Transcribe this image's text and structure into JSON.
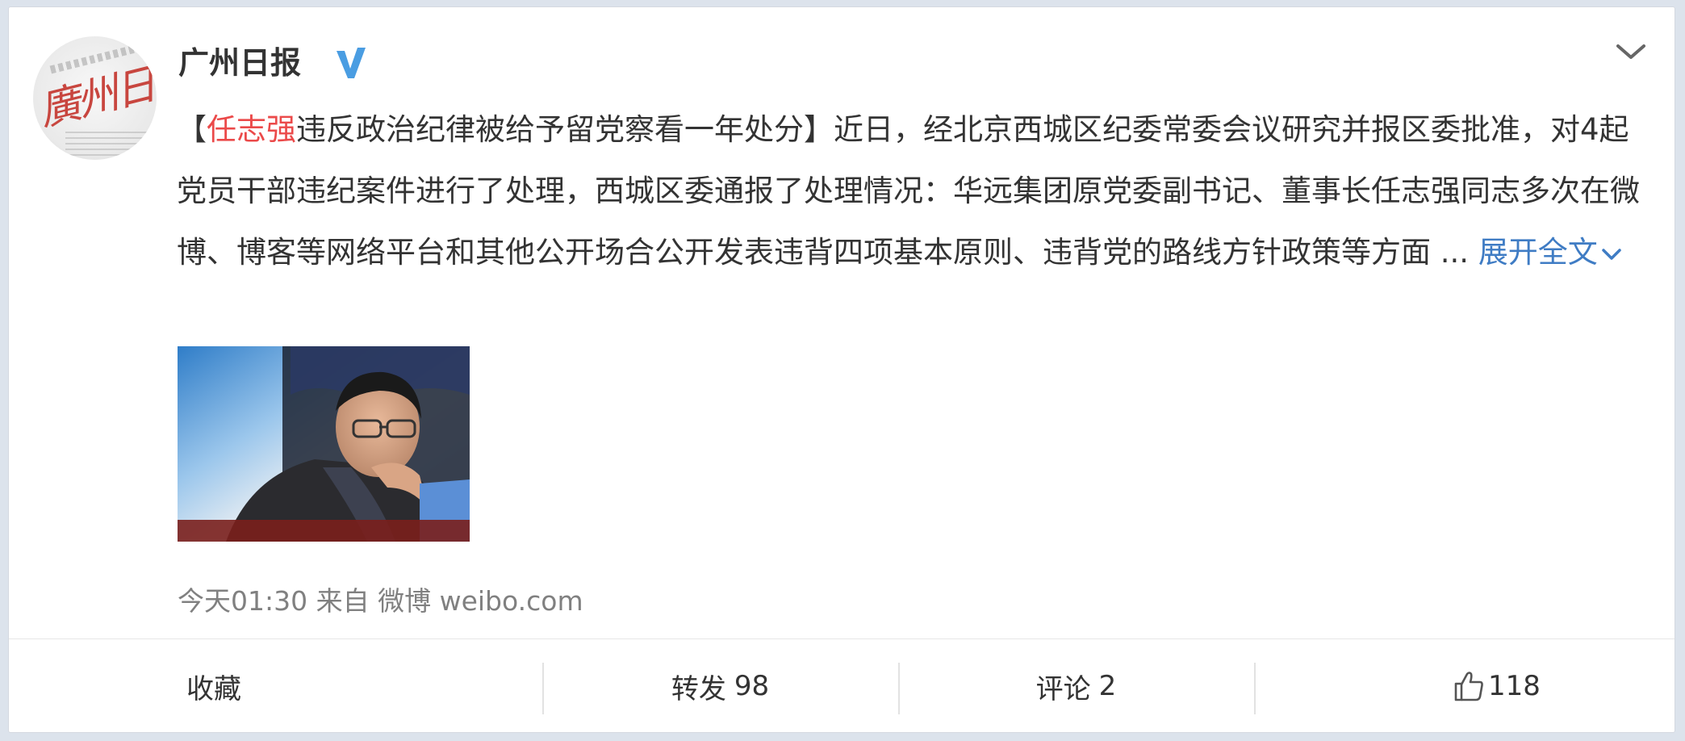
{
  "post": {
    "author": "广州日报",
    "verified_icon": "verified-v-icon",
    "menu_icon": "chevron-down-icon",
    "text": {
      "open_bracket": "【",
      "mention": "任志强",
      "headline_rest": "违反政治纪律被给予留党察看一年处分】",
      "body": "近日，经北京西城区纪委常委会议研究并报区委批准，对4起党员干部违纪案件进行了处理，西城区委通报了处理情况：华远集团原党委副书记、董事长任志强同志多次在微博、博客等网络平台和其他公开场合公开发表违背四项基本原则、违背党的路线方针政策等方面 ...",
      "expand_label": "展开全文"
    },
    "meta": {
      "time": "今天01:30",
      "from_label": "来自",
      "source": "微博 weibo.com"
    }
  },
  "actions": {
    "favorite": "收藏",
    "repost_label": "转发",
    "repost_count": "98",
    "comment_label": "评论",
    "comment_count": "2",
    "like_icon": "thumbs-up-icon",
    "like_count": "118"
  },
  "colors": {
    "mention": "#eb4a4a",
    "link": "#3f7cc4",
    "verified": "#4a9de2",
    "meta": "#808080"
  }
}
